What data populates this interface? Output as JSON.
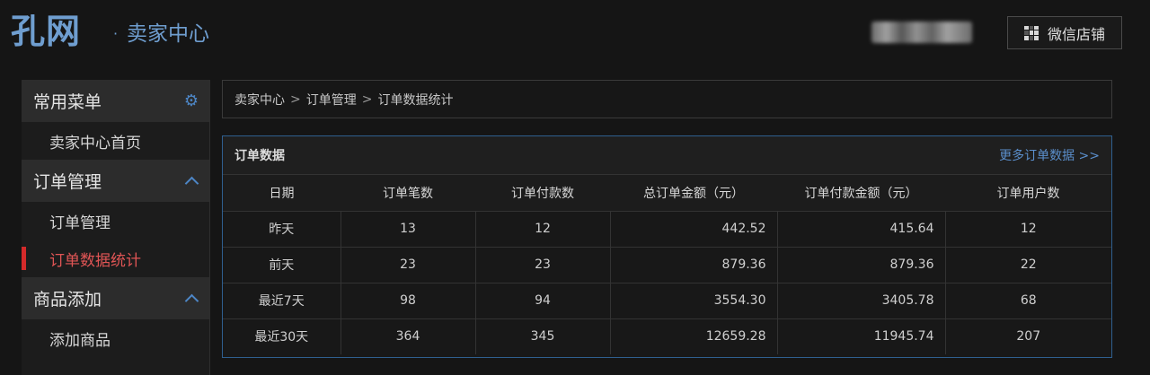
{
  "header": {
    "logo": "孔网",
    "subtitle": "卖家中心",
    "wechat_button": "微信店铺"
  },
  "sidebar": {
    "sections": [
      {
        "title": "常用菜单",
        "icon": "gear-icon",
        "items": [
          "卖家中心首页"
        ]
      },
      {
        "title": "订单管理",
        "icon": "chevron-up-icon",
        "items": [
          "订单管理",
          "订单数据统计"
        ]
      },
      {
        "title": "商品添加",
        "icon": "chevron-up-icon",
        "items": [
          "添加商品"
        ]
      }
    ],
    "active_item": "订单数据统计"
  },
  "breadcrumb": [
    "卖家中心",
    "订单管理",
    "订单数据统计"
  ],
  "breadcrumb_sep": ">",
  "panel": {
    "title": "订单数据",
    "more_link": "更多订单数据 >>",
    "columns": [
      "日期",
      "订单笔数",
      "订单付款数",
      "总订单金额（元）",
      "订单付款金额（元）",
      "订单用户数"
    ],
    "rows": [
      [
        "昨天",
        "13",
        "12",
        "442.52",
        "415.64",
        "12"
      ],
      [
        "前天",
        "23",
        "23",
        "879.36",
        "879.36",
        "22"
      ],
      [
        "最近7天",
        "98",
        "94",
        "3554.30",
        "3405.78",
        "68"
      ],
      [
        "最近30天",
        "364",
        "345",
        "12659.28",
        "11945.74",
        "207"
      ]
    ]
  }
}
